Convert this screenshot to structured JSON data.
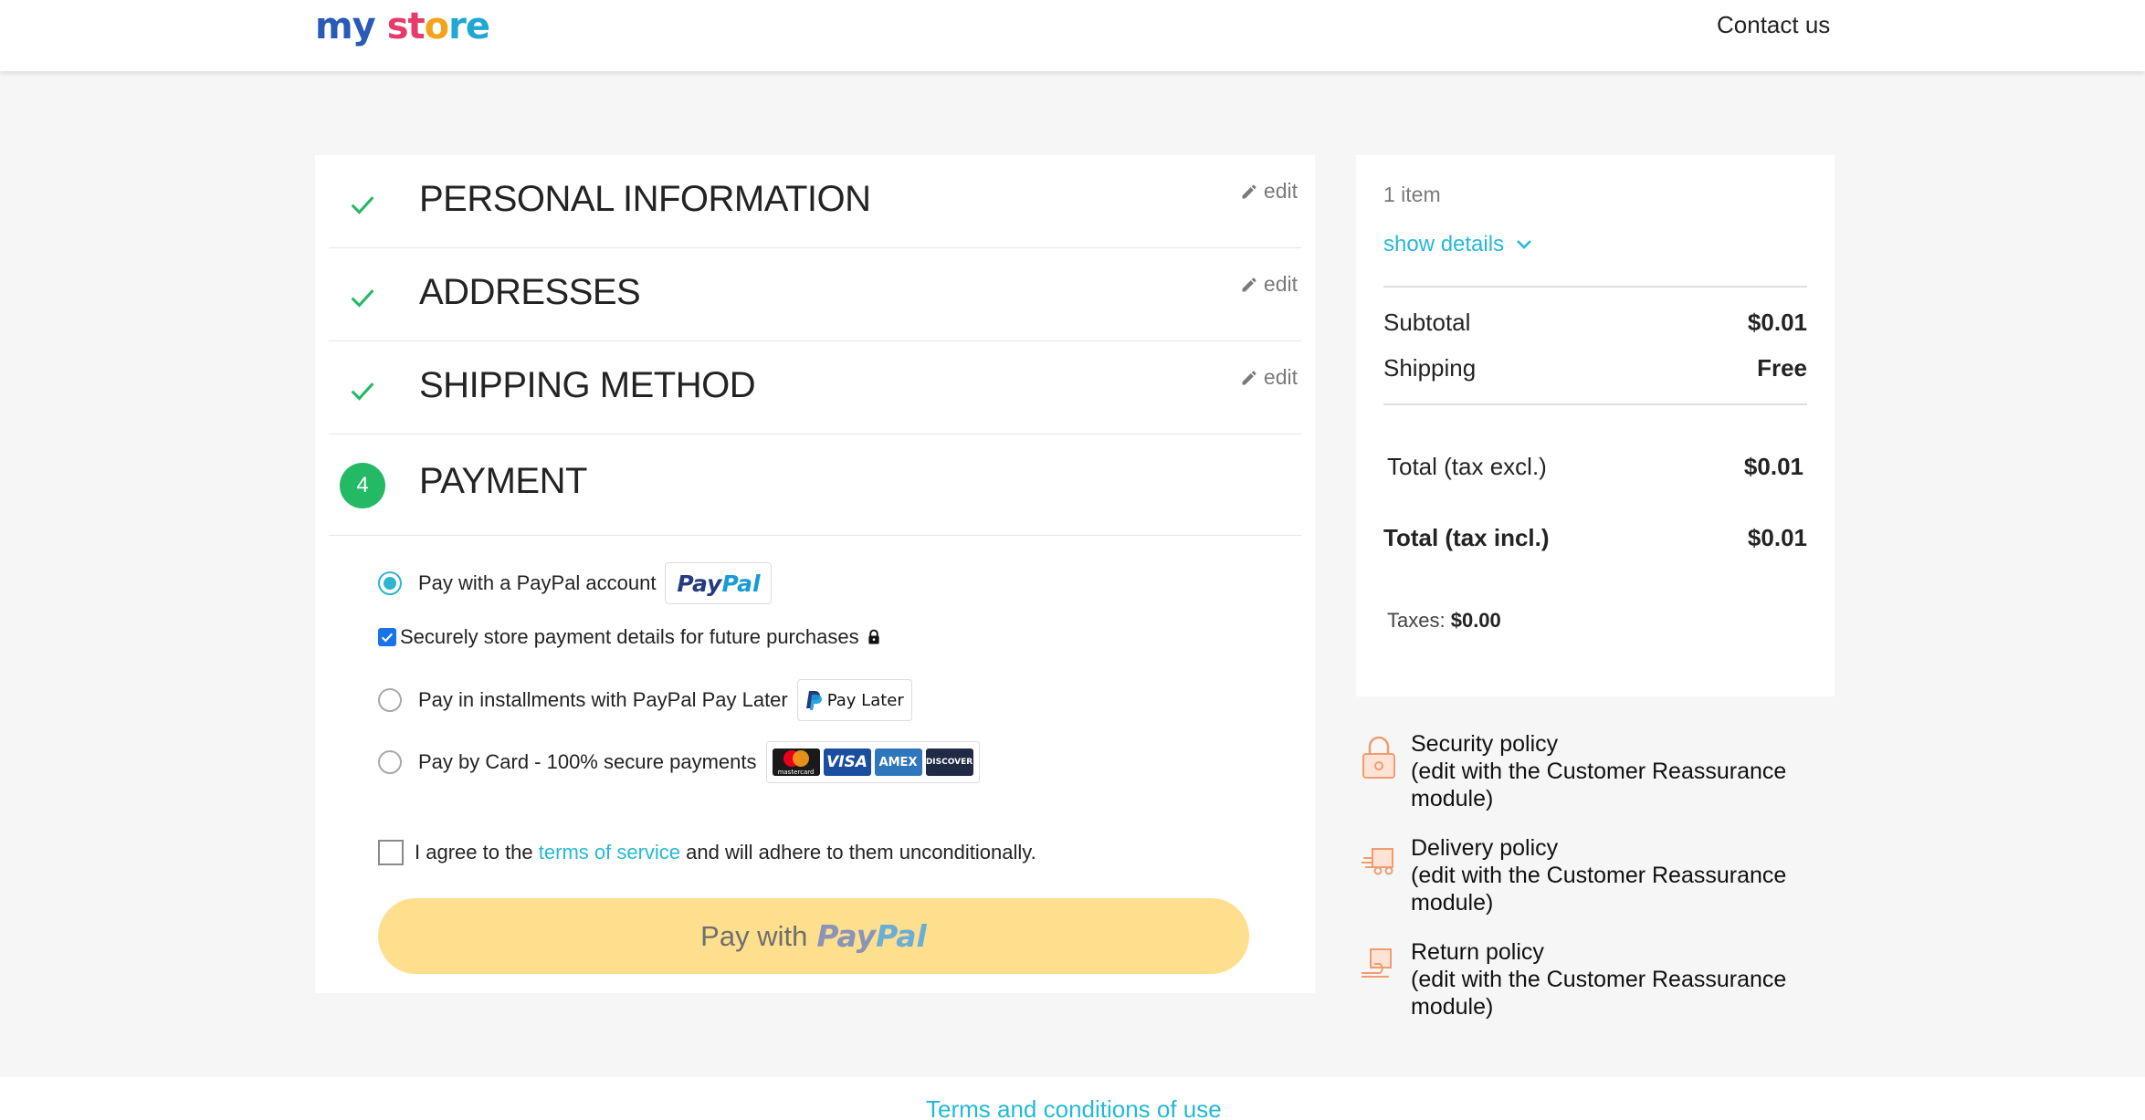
{
  "header": {
    "logo_parts": [
      "my",
      " ",
      "st",
      "o",
      "re"
    ],
    "contact_label": "Contact us"
  },
  "steps": [
    {
      "title": "Personal Information",
      "edit_label": "edit",
      "status": "complete"
    },
    {
      "title": "Addresses",
      "edit_label": "edit",
      "status": "complete"
    },
    {
      "title": "Shipping Method",
      "edit_label": "edit",
      "status": "complete"
    },
    {
      "title": "Payment",
      "number": "4",
      "status": "current"
    }
  ],
  "payment": {
    "options": [
      {
        "label": "Pay with a PayPal account",
        "selected": true
      },
      {
        "label": "Pay in installments with PayPal Pay Later",
        "selected": false,
        "badge": "Pay Later"
      },
      {
        "label": "Pay by Card - 100% secure payments",
        "selected": false,
        "cards": [
          "mastercard",
          "VISA",
          "AMEX",
          "DISCOVER"
        ]
      }
    ],
    "store_details_label": "Securely store payment details for future purchases",
    "store_details_checked": true,
    "paypal_logo": {
      "pay": "Pay",
      "pal": "Pal"
    },
    "terms": {
      "prefix": "I agree to the ",
      "link": "terms of service",
      "suffix": " and will adhere to them unconditionally.",
      "checked": false
    },
    "pay_button": {
      "prefix": "Pay with",
      "pay": "Pay",
      "pal": "Pal"
    }
  },
  "summary": {
    "items_count": "1 item",
    "show_details": "show details",
    "subtotal_label": "Subtotal",
    "subtotal_value": "$0.01",
    "shipping_label": "Shipping",
    "shipping_value": "Free",
    "total_excl_label": "Total (tax excl.)",
    "total_excl_value": "$0.01",
    "total_incl_label": "Total (tax incl.)",
    "total_incl_value": "$0.01",
    "taxes_label": "Taxes:",
    "taxes_value": "$0.00"
  },
  "reassurance": [
    {
      "title": "Security policy",
      "desc": "(edit with the Customer Reassurance module)"
    },
    {
      "title": "Delivery policy",
      "desc": "(edit with the Customer Reassurance module)"
    },
    {
      "title": "Return policy",
      "desc": "(edit with the Customer Reassurance module)"
    }
  ],
  "footer": {
    "terms_link": "Terms and conditions of use"
  },
  "colors": {
    "accent": "#24b9d7",
    "success": "#24b964",
    "paypal_button": "#fedf8e"
  }
}
